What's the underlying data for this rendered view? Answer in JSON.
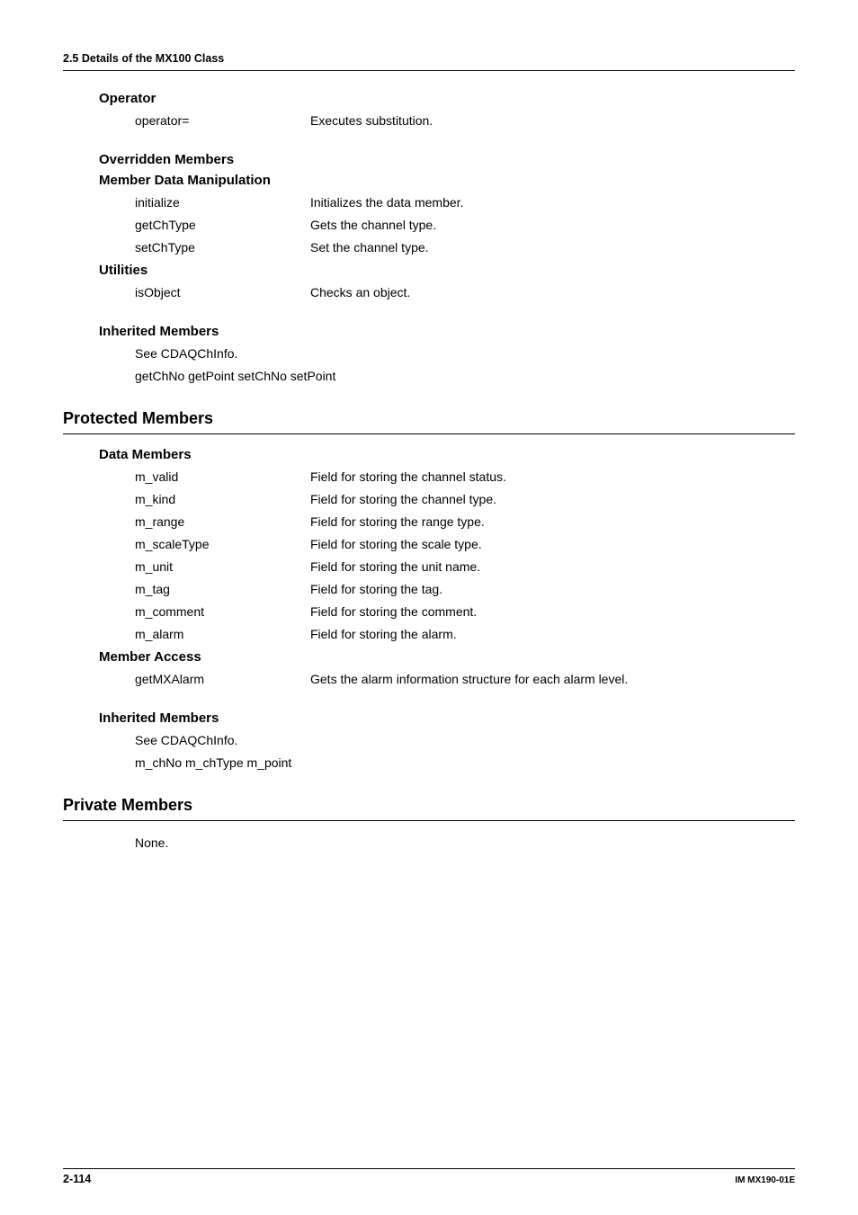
{
  "header": "2.5  Details of the MX100 Class",
  "operator": {
    "title": "Operator",
    "rows": [
      {
        "term": "operator=",
        "def": "Executes substitution."
      }
    ]
  },
  "overridden": {
    "title": "Overridden Members",
    "sub1": {
      "title": "Member Data Manipulation",
      "rows": [
        {
          "term": "initialize",
          "def": "Initializes the data member."
        },
        {
          "term": "getChType",
          "def": "Gets the channel type."
        },
        {
          "term": "setChType",
          "def": "Set the channel type."
        }
      ]
    },
    "sub2": {
      "title": "Utilities",
      "rows": [
        {
          "term": "isObject",
          "def": "Checks an object."
        }
      ]
    }
  },
  "inherited1": {
    "title": "Inherited Members",
    "line1": "See CDAQChInfo.",
    "line2": "getChNo getPoint setChNo setPoint"
  },
  "protected": {
    "title": "Protected Members",
    "data_members": {
      "title": "Data Members",
      "rows": [
        {
          "term": "m_valid",
          "def": "Field for storing the channel status."
        },
        {
          "term": "m_kind",
          "def": "Field for storing the channel type."
        },
        {
          "term": "m_range",
          "def": "Field for storing the range type."
        },
        {
          "term": "m_scaleType",
          "def": "Field for storing the scale type."
        },
        {
          "term": "m_unit",
          "def": "Field for storing the unit name."
        },
        {
          "term": "m_tag",
          "def": "Field for storing the tag."
        },
        {
          "term": "m_comment",
          "def": "Field for storing the comment."
        },
        {
          "term": "m_alarm",
          "def": "Field for storing the alarm."
        }
      ]
    },
    "member_access": {
      "title": "Member Access",
      "rows": [
        {
          "term": "getMXAlarm",
          "def": "Gets the alarm information structure for each alarm level."
        }
      ]
    }
  },
  "inherited2": {
    "title": "Inherited Members",
    "line1": "See CDAQChInfo.",
    "line2": "m_chNo m_chType m_point"
  },
  "private": {
    "title": "Private Members",
    "body": "None."
  },
  "footer": {
    "page": "2-114",
    "doc": "IM MX190-01E"
  }
}
